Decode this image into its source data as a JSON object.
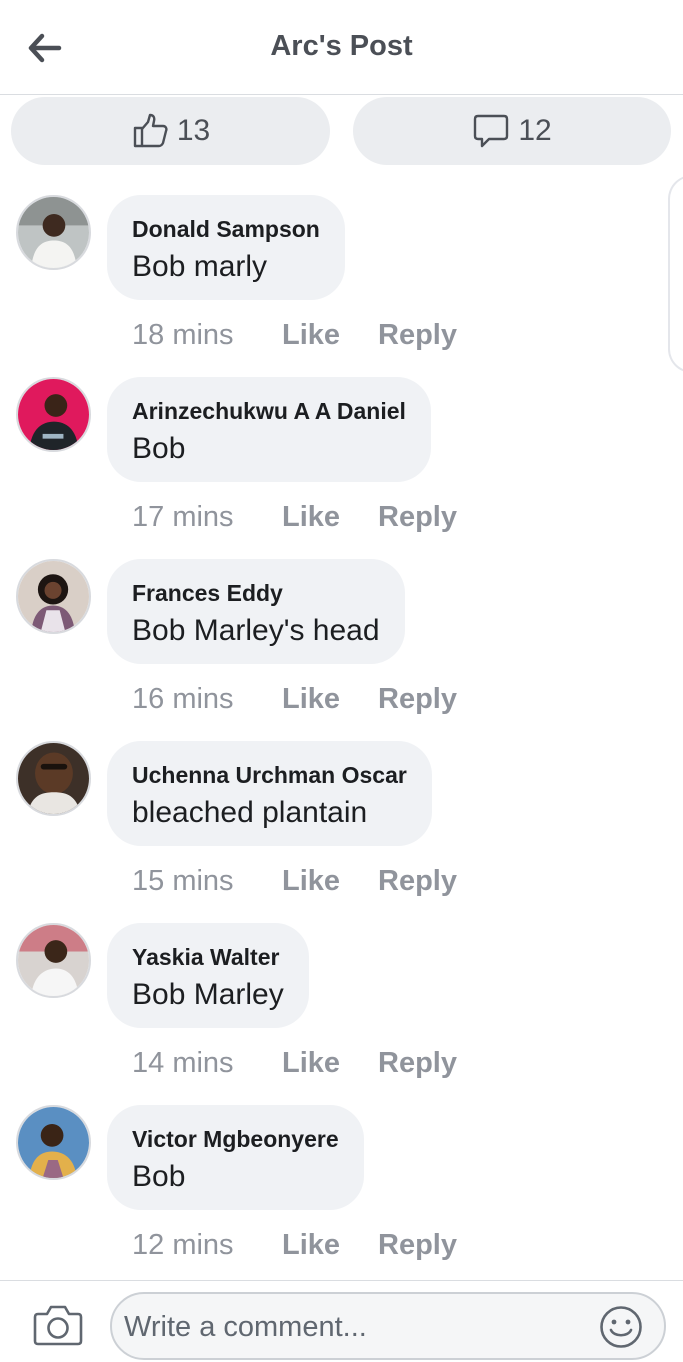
{
  "header": {
    "title": "Arc's Post",
    "back_icon": "arrow-left-icon"
  },
  "reactions": {
    "likes_count": "13",
    "comments_count": "12",
    "like_icon": "thumbs-up-icon",
    "comment_icon": "comment-bubble-icon"
  },
  "actions": {
    "like_label": "Like",
    "reply_label": "Reply"
  },
  "comments": [
    {
      "author": "Donald Sampson",
      "text": "Bob marly",
      "time": "18 mins"
    },
    {
      "author": "Arinzechukwu A A Daniel",
      "text": "Bob",
      "time": "17 mins"
    },
    {
      "author": "Frances Eddy",
      "text": "Bob Marley's head",
      "time": "16 mins"
    },
    {
      "author": "Uchenna Urchman Oscar",
      "text": "bleached plantain",
      "time": "15 mins"
    },
    {
      "author": "Yaskia Walter",
      "text": "Bob Marley",
      "time": "14 mins"
    },
    {
      "author": "Victor Mgbeonyere",
      "text": "Bob",
      "time": "12 mins"
    }
  ],
  "composer": {
    "placeholder": "Write a comment...",
    "camera_icon": "camera-icon",
    "emoji_icon": "smiley-icon"
  },
  "colors": {
    "pill_bg": "#ebedf0",
    "bubble_bg": "#f0f2f5",
    "muted_text": "#90949c",
    "header_text": "#4b4f56"
  }
}
